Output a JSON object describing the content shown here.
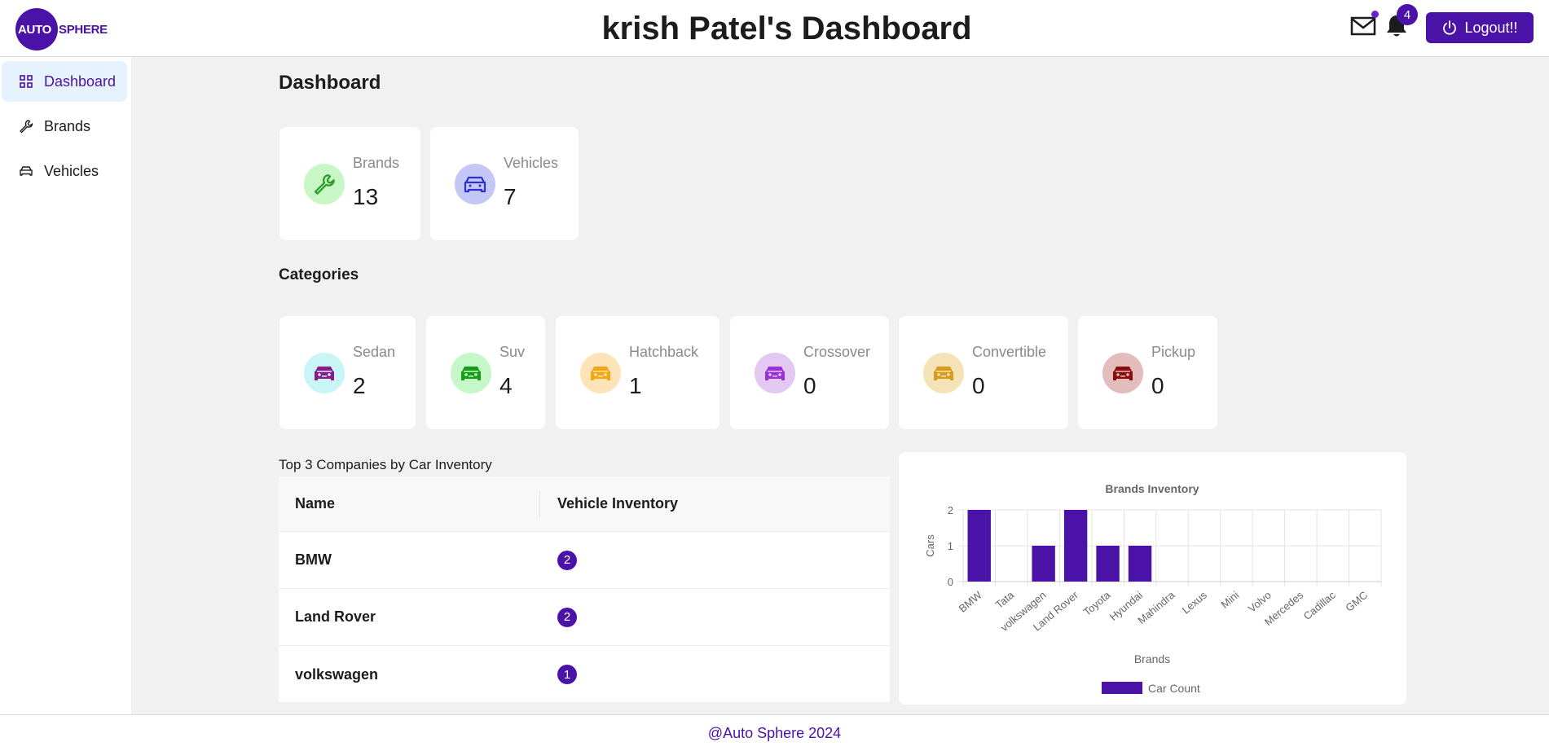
{
  "header": {
    "logo_auto": "AUTO",
    "logo_sphere": "SPHERE",
    "title": "krish Patel's Dashboard",
    "notification_count": "4",
    "logout_label": "Logout!!"
  },
  "sidebar": {
    "items": [
      {
        "label": "Dashboard",
        "icon": "grid-icon",
        "active": true
      },
      {
        "label": "Brands",
        "icon": "wrench-icon",
        "active": false
      },
      {
        "label": "Vehicles",
        "icon": "car-icon",
        "active": false
      }
    ]
  },
  "main": {
    "title": "Dashboard",
    "summary": [
      {
        "label": "Brands",
        "value": "13",
        "icon": "wrench-icon",
        "bg": "#c8f7c5",
        "fg": "#2e9e2e"
      },
      {
        "label": "Vehicles",
        "value": "7",
        "icon": "car-icon",
        "bg": "#c5c8f7",
        "fg": "#2a32c9"
      }
    ],
    "categories_title": "Categories",
    "categories": [
      {
        "label": "Sedan",
        "value": "2",
        "bg": "#c9f5f7",
        "fg": "#8a1a8a"
      },
      {
        "label": "Suv",
        "value": "4",
        "bg": "#c5f7c9",
        "fg": "#159e15"
      },
      {
        "label": "Hatchback",
        "value": "1",
        "bg": "#fde4b8",
        "fg": "#f2a711"
      },
      {
        "label": "Crossover",
        "value": "0",
        "bg": "#e3c8f2",
        "fg": "#9b30d8"
      },
      {
        "label": "Convertible",
        "value": "0",
        "bg": "#f5e3b8",
        "fg": "#d99c1a"
      },
      {
        "label": "Pickup",
        "value": "0",
        "bg": "#e3bcbc",
        "fg": "#8a0c0c"
      }
    ],
    "table_title": "Top 3 Companies by Car Inventory",
    "table": {
      "columns": [
        "Name",
        "Vehicle Inventory"
      ],
      "rows": [
        {
          "name": "BMW",
          "inventory": "2"
        },
        {
          "name": "Land Rover",
          "inventory": "2"
        },
        {
          "name": "volkswagen",
          "inventory": "1"
        }
      ]
    }
  },
  "chart_data": {
    "type": "bar",
    "title": "Brands Inventory",
    "xlabel": "Brands",
    "ylabel": "Cars",
    "ylim": [
      0,
      2
    ],
    "yticks": [
      "0",
      "1",
      "2"
    ],
    "categories": [
      "BMW",
      "Tata",
      "volkswagen",
      "Land Rover",
      "Toyota",
      "Hyundai",
      "Mahindra",
      "Lexus",
      "Mini",
      "Volvo",
      "Mercedes",
      "Cadillac",
      "GMC"
    ],
    "series": [
      {
        "name": "Car Count",
        "values": [
          2,
          0,
          1,
          2,
          1,
          1,
          0,
          0,
          0,
          0,
          0,
          0,
          0
        ],
        "color": "#4b12a8"
      }
    ],
    "grid": true,
    "legend": "bottom"
  },
  "footer": {
    "text": "@Auto Sphere 2024"
  }
}
